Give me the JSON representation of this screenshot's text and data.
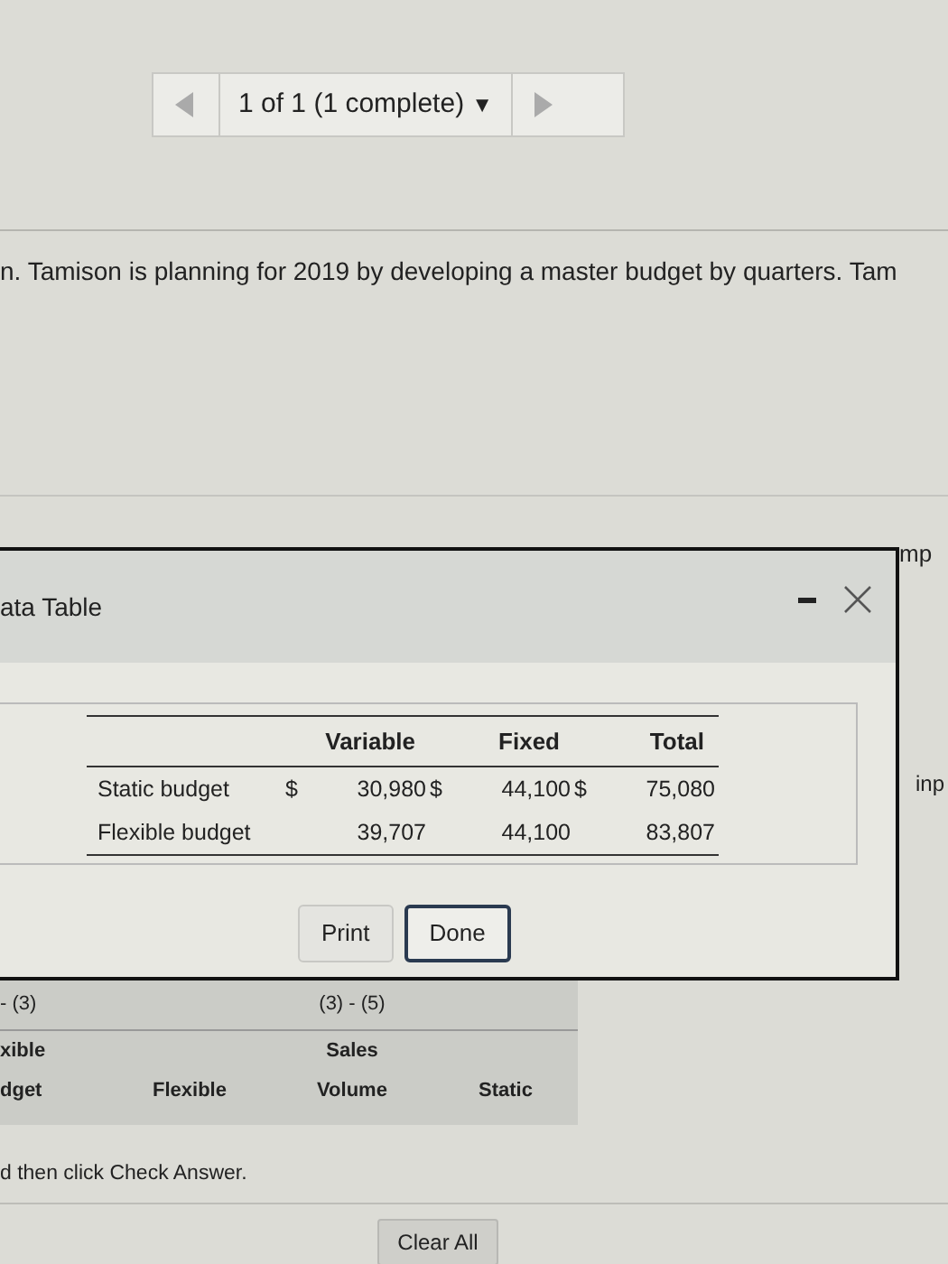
{
  "navigator": {
    "status": "1 of 1 (1 complete)",
    "dropdown_glyph": "▼"
  },
  "question_text": "n. Tamison is planning for 2019 by developing a master budget by quarters. Tam",
  "edge_texts": [
    "mp",
    "inp"
  ],
  "dialog": {
    "title": "ata Table",
    "table": {
      "columns": [
        "Variable",
        "Fixed",
        "Total"
      ],
      "rows": [
        {
          "label": "Static budget",
          "cells": [
            {
              "currency": "$",
              "amount": "30,980"
            },
            {
              "currency": "$",
              "amount": "44,100"
            },
            {
              "currency": "$",
              "amount": "75,080"
            }
          ]
        },
        {
          "label": "Flexible budget",
          "cells": [
            {
              "amount": "39,707"
            },
            {
              "amount": "44,100"
            },
            {
              "amount": "83,807"
            }
          ]
        }
      ]
    },
    "buttons": [
      {
        "label": "Print",
        "focused": false
      },
      {
        "label": "Done",
        "focused": true
      }
    ]
  },
  "background_table": {
    "header_row": {
      "column_1": "- (3)",
      "column_3": "(3) - (5)"
    },
    "rows": [
      {
        "column_1": "xible",
        "column_3": "Sales"
      },
      {
        "column_1": "dget",
        "column_2": "Flexible",
        "column_3": "Volume",
        "column_4": "Static"
      }
    ]
  },
  "instruction": "d then click Check Answer.",
  "clear_button": "Clear All"
}
